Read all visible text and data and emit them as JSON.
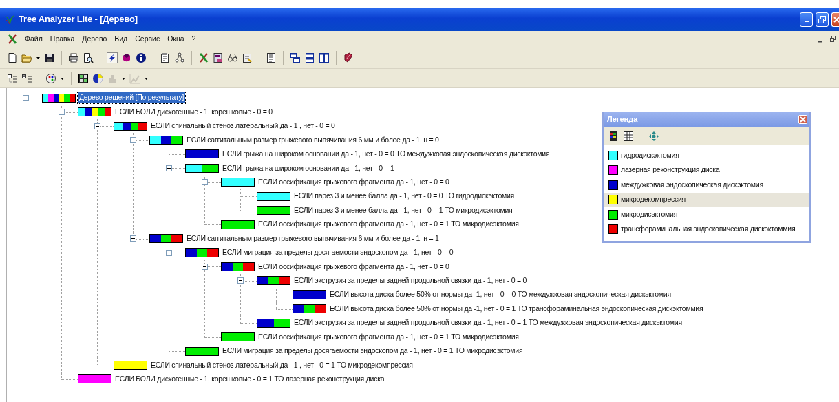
{
  "window": {
    "title": "Tree Analyzer Lite - [Дерево]"
  },
  "menu": [
    "Файл",
    "Правка",
    "Дерево",
    "Вид",
    "Сервис",
    "Окна",
    "?"
  ],
  "tree": {
    "label": "Дерево решений [По результату]",
    "selected": true,
    "expanded": true,
    "segments": [
      {
        "color": "#33ffff"
      },
      {
        "color": "#ff00ff"
      },
      {
        "color": "#0000cc"
      },
      {
        "color": "#ffff00"
      },
      {
        "color": "#00ee00"
      },
      {
        "color": "#ee0000"
      }
    ],
    "children": [
      {
        "label": "ЕСЛИ БОЛИ дискогенные - 1, корешковые -  0 = 0",
        "selected": false,
        "expanded": true,
        "segments": [
          {
            "color": "#33ffff"
          },
          {
            "color": "#0000cc"
          },
          {
            "color": "#ffff00"
          },
          {
            "color": "#00ee00"
          },
          {
            "color": "#ee0000"
          }
        ],
        "children": [
          {
            "label": "ЕСЛИ спинальный стеноз латеральный да - 1 , нет - 0 = 0",
            "selected": false,
            "expanded": true,
            "segments": [
              {
                "color": "#33ffff"
              },
              {
                "color": "#0000cc"
              },
              {
                "color": "#00ee00"
              },
              {
                "color": "#ee0000"
              }
            ],
            "children": [
              {
                "label": "ЕСЛИ саггитальным размер грыжевого выпячивания 6 мм и более да - 1, н = 0",
                "selected": false,
                "expanded": true,
                "segments": [
                  {
                    "color": "#33ffff"
                  },
                  {
                    "color": "#0000cc"
                  },
                  {
                    "color": "#00ee00"
                  }
                ],
                "children": [
                  {
                    "label": "ЕСЛИ грыжа на широком основании да - 1, нет - 0 = 0 ТО междужковая эндоскопическая дискэктомия",
                    "selected": false,
                    "segments": [
                      {
                        "color": "#0000cc"
                      }
                    ]
                  },
                  {
                    "label": "ЕСЛИ грыжа на широком основании да - 1, нет - 0 = 1",
                    "selected": false,
                    "expanded": true,
                    "segments": [
                      {
                        "color": "#33ffff"
                      },
                      {
                        "color": "#00ee00"
                      }
                    ],
                    "children": [
                      {
                        "label": "ЕСЛИ оссификация грыжевого фрагмента да  - 1, нет - 0 = 0",
                        "selected": false,
                        "expanded": true,
                        "segments": [
                          {
                            "color": "#33ffff"
                          }
                        ],
                        "children": [
                          {
                            "label": "ЕСЛИ парез 3 и менее балла да  - 1, нет - 0 = 0 ТО гидродискэктомия",
                            "selected": false,
                            "segments": [
                              {
                                "color": "#33ffff"
                              }
                            ]
                          },
                          {
                            "label": "ЕСЛИ парез 3 и менее балла да  - 1, нет - 0 = 1 ТО микродисэктомия",
                            "selected": false,
                            "segments": [
                              {
                                "color": "#00ee00"
                              }
                            ]
                          }
                        ]
                      },
                      {
                        "label": "ЕСЛИ оссификация грыжевого фрагмента да  - 1, нет - 0 = 1 ТО микродисэктомия",
                        "selected": false,
                        "segments": [
                          {
                            "color": "#00ee00"
                          }
                        ]
                      }
                    ]
                  }
                ]
              },
              {
                "label": "ЕСЛИ саггитальным размер грыжевого выпячивания 6 мм и более да - 1, н = 1",
                "selected": false,
                "expanded": true,
                "segments": [
                  {
                    "color": "#0000cc"
                  },
                  {
                    "color": "#00ee00"
                  },
                  {
                    "color": "#ee0000"
                  }
                ],
                "children": [
                  {
                    "label": "ЕСЛИ миграция за   пределы досягаемости эндоскопом да - 1, нет - 0 = 0",
                    "selected": false,
                    "expanded": true,
                    "segments": [
                      {
                        "color": "#0000cc"
                      },
                      {
                        "color": "#00ee00"
                      },
                      {
                        "color": "#ee0000"
                      }
                    ],
                    "children": [
                      {
                        "label": "ЕСЛИ оссификация грыжевого фрагмента да  - 1, нет - 0 = 0",
                        "selected": false,
                        "expanded": true,
                        "segments": [
                          {
                            "color": "#0000cc"
                          },
                          {
                            "color": "#00ee00"
                          },
                          {
                            "color": "#ee0000"
                          }
                        ],
                        "children": [
                          {
                            "label": "ЕСЛИ экструзия за пределы задней продольной связки да - 1, нет - 0 = 0",
                            "selected": false,
                            "expanded": true,
                            "segments": [
                              {
                                "color": "#0000cc"
                              },
                              {
                                "color": "#00ee00"
                              },
                              {
                                "color": "#ee0000"
                              }
                            ],
                            "children": [
                              {
                                "label": "ЕСЛИ высота диска более 50% от нормы  да -1, нет - 0 = 0 ТО междужковая эндоскопическая дискэктомия",
                                "selected": false,
                                "segments": [
                                  {
                                    "color": "#0000cc"
                                  }
                                ]
                              },
                              {
                                "label": "ЕСЛИ высота диска более 50% от нормы  да -1, нет - 0 = 1 ТО трансфораминальная эндоскопическая дискэктоммия",
                                "selected": false,
                                "segments": [
                                  {
                                    "color": "#0000cc"
                                  },
                                  {
                                    "color": "#00ee00"
                                  },
                                  {
                                    "color": "#ee0000"
                                  }
                                ]
                              }
                            ]
                          },
                          {
                            "label": "ЕСЛИ экструзия за пределы задней продольной связки да - 1, нет - 0 = 1 ТО междужковая эндоскопическая дискэктомия",
                            "selected": false,
                            "segments": [
                              {
                                "color": "#0000cc"
                              },
                              {
                                "color": "#00ee00"
                              }
                            ]
                          }
                        ]
                      },
                      {
                        "label": "ЕСЛИ оссификация грыжевого фрагмента да  - 1, нет - 0 = 1 ТО микродисэктомия",
                        "selected": false,
                        "segments": [
                          {
                            "color": "#00ee00"
                          }
                        ]
                      }
                    ]
                  },
                  {
                    "label": "ЕСЛИ миграция за   пределы досягаемости эндоскопом да - 1, нет - 0 = 1 ТО микродисэктомия",
                    "selected": false,
                    "segments": [
                      {
                        "color": "#00ee00"
                      }
                    ]
                  }
                ]
              }
            ]
          },
          {
            "label": "ЕСЛИ спинальный стеноз латеральный да - 1 , нет - 0 = 1 ТО микродекомпрессия",
            "selected": false,
            "segments": [
              {
                "color": "#ffff00"
              }
            ]
          }
        ]
      },
      {
        "label": "ЕСЛИ БОЛИ дискогенные - 1, корешковые -  0 = 1 ТО лазерная реконструкция диска",
        "selected": false,
        "segments": [
          {
            "color": "#ff00ff"
          }
        ]
      }
    ]
  },
  "legend": {
    "title": "Легенда",
    "items": [
      {
        "label": "гидродискэктомия",
        "color": "#33ffff",
        "selected": false
      },
      {
        "label": "лазерная реконструкция диска",
        "color": "#ff00ff",
        "selected": false
      },
      {
        "label": "междужковая эндоскопическая дискэктомия",
        "color": "#0000cc",
        "selected": false
      },
      {
        "label": "микродекомпрессия",
        "color": "#ffff00",
        "selected": true
      },
      {
        "label": "микродисэктомия",
        "color": "#00ee00",
        "selected": false
      },
      {
        "label": "трансфораминальная эндоскопическая дискэктоммия",
        "color": "#ee0000",
        "selected": false
      }
    ]
  }
}
